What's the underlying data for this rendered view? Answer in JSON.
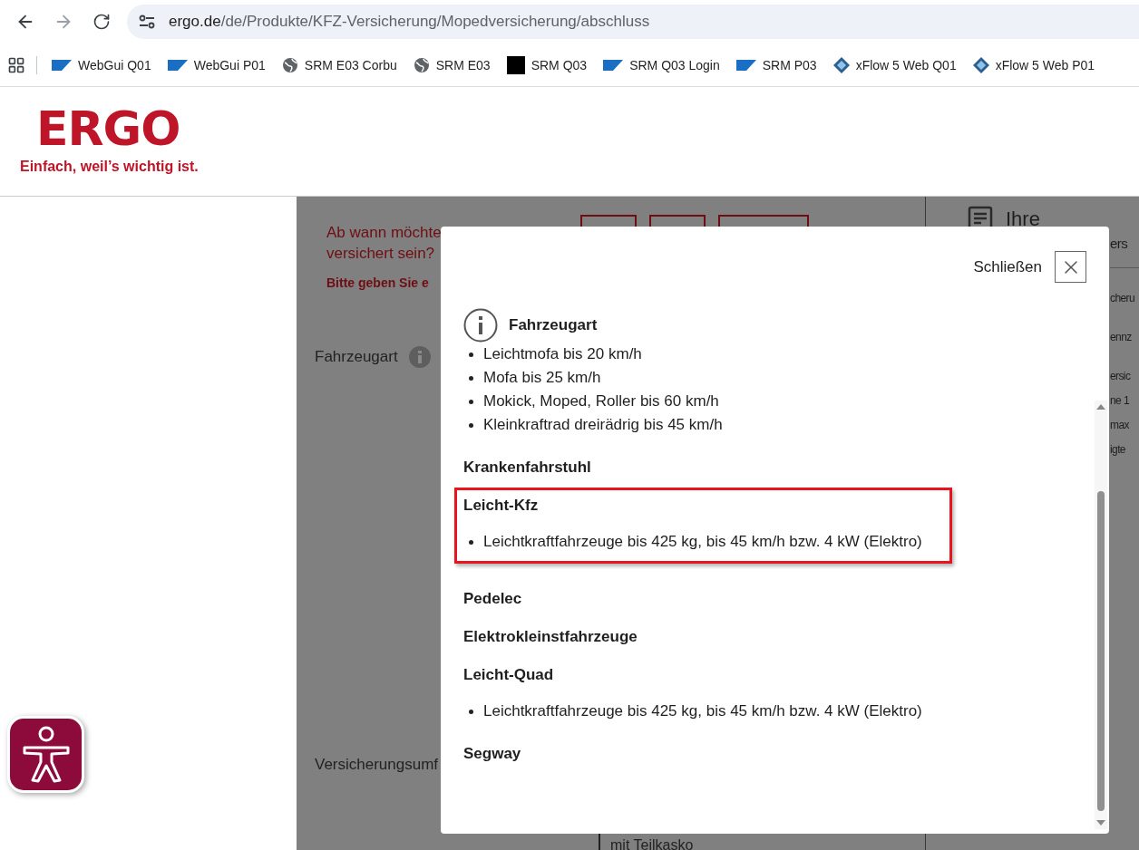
{
  "browser": {
    "url_host": "ergo.de",
    "url_path": "/de/Produkte/KFZ-Versicherung/Mopedversicherung/abschluss",
    "bookmarks": [
      {
        "label": "WebGui Q01",
        "kind": "sap"
      },
      {
        "label": "WebGui P01",
        "kind": "sap"
      },
      {
        "label": "SRM E03 Corbu",
        "kind": "globe"
      },
      {
        "label": "SRM E03",
        "kind": "globe"
      },
      {
        "label": "SRM Q03",
        "kind": "square"
      },
      {
        "label": "SRM Q03 Login",
        "kind": "sap"
      },
      {
        "label": "SRM P03",
        "kind": "sap"
      },
      {
        "label": "xFlow 5 Web Q01",
        "kind": "diamond"
      },
      {
        "label": "xFlow 5 Web P01",
        "kind": "diamond"
      }
    ]
  },
  "header": {
    "logo": "ERGO",
    "tagline": "Einfach, weil’s wichtig ist."
  },
  "form": {
    "question_lines": [
      "Ab wann möchte",
      "versichert sein?"
    ],
    "error": "Bitte geben Sie e",
    "vehicle_label": "Fahrzeugart",
    "coverage_label": "Versicherungsumf",
    "coverage_option": "mit Teilkasko"
  },
  "summary": {
    "title_lines": [
      "Ihre",
      "ers"
    ],
    "groups": [
      [
        "cheru"
      ],
      [
        "ennz"
      ],
      [
        "ersic",
        "ne 1",
        "max",
        "igte"
      ]
    ]
  },
  "modal": {
    "close_label": "Schließen",
    "sections": [
      {
        "kind": "info",
        "title": "Fahrzeugart",
        "highlighted": false,
        "bullets": [
          "Leichtmofa bis 20 km/h",
          "Mofa bis 25 km/h",
          "Mokick, Moped, Roller bis 60 km/h",
          "Kleinkraftrad dreirädrig bis 45 km/h"
        ]
      },
      {
        "kind": "plain",
        "title": "Krankenfahrstuhl",
        "highlighted": false
      },
      {
        "kind": "plain",
        "title": "Leicht-Kfz",
        "highlighted": true,
        "bullets": [
          "Leichtkraftfahrzeuge bis 425 kg, bis 45 km/h bzw. 4 kW (Elektro)"
        ]
      },
      {
        "kind": "plain",
        "title": "Pedelec",
        "highlighted": false
      },
      {
        "kind": "plain",
        "title": "Elektrokleinstfahrzeuge",
        "highlighted": false
      },
      {
        "kind": "plain",
        "title": "Leicht-Quad",
        "highlighted": false,
        "bullets": [
          "Leichtkraftfahrzeuge bis 425 kg, bis 45 km/h bzw. 4 kW (Elektro)"
        ]
      },
      {
        "kind": "plain",
        "title": "Segway",
        "highlighted": false
      }
    ]
  }
}
